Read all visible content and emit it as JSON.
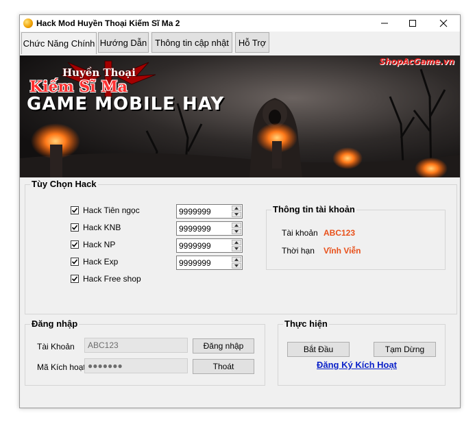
{
  "window": {
    "title": "Hack Mod Huyền Thoại Kiếm Sĩ Ma 2"
  },
  "tabs": [
    {
      "label": "Chức Năng Chính",
      "active": true
    },
    {
      "label": "Hướng Dẫn",
      "active": false
    },
    {
      "label": "Thông tin cập nhật",
      "active": false
    },
    {
      "label": "Hỗ Trợ",
      "active": false
    }
  ],
  "banner": {
    "subtitle": "Huyền Thoại",
    "title": "Kiếm Sĩ Ma",
    "tagline": "GAME MOBILE HAY",
    "watermark": "ShopAcGame.vn"
  },
  "hack_options": {
    "title": "Tùy Chọn Hack",
    "items": [
      {
        "label": "Hack Tiên ngọc",
        "checked": true,
        "value": "9999999"
      },
      {
        "label": "Hack KNB",
        "checked": true,
        "value": "9999999"
      },
      {
        "label": "Hack NP",
        "checked": true,
        "value": "9999999"
      },
      {
        "label": "Hack Exp",
        "checked": true,
        "value": "9999999"
      },
      {
        "label": "Hack Free shop",
        "checked": true
      }
    ]
  },
  "account_info": {
    "title": "Thông tin tài khoản",
    "account_label": "Tài khoản",
    "account_value": "ABC123",
    "duration_label": "Thời hạn",
    "duration_value": "Vĩnh Viễn",
    "value_color": "#e8501a"
  },
  "login": {
    "title": "Đăng nhập",
    "account_label": "Tài Khoản",
    "account_value": "ABC123",
    "code_label": "Mã Kích hoạt",
    "code_value": "●●●●●●●",
    "login_button": "Đăng nhập",
    "exit_button": "Thoát"
  },
  "actions": {
    "title": "Thực hiện",
    "start_button": "Bắt Đầu",
    "pause_button": "Tạm Dừng",
    "register_link": "Đăng Ký Kích Hoạt",
    "link_color": "#0b22c9"
  }
}
